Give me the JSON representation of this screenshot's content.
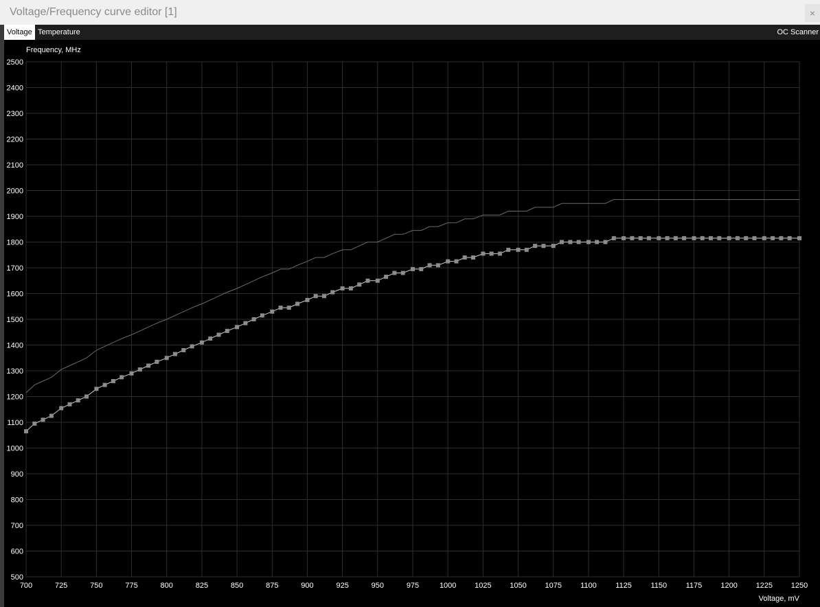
{
  "window": {
    "title": "Voltage/Frequency curve editor [1]",
    "close_glyph": "×"
  },
  "tabs": [
    {
      "label": "Voltage",
      "active": true
    },
    {
      "label": "Temperature",
      "active": false
    }
  ],
  "toolbar": {
    "oc_scanner_label": "OC Scanner"
  },
  "colors": {
    "background": "#000000",
    "grid": "#2e2e2e",
    "curve": "#d0d0d0",
    "upper_line": "#6a6a6a",
    "point": "#8c8c8c",
    "text": "#ffffff"
  },
  "chart_data": {
    "type": "line",
    "ylabel": "Frequency, MHz",
    "xlabel": "Voltage, mV",
    "xlim": [
      700,
      1250
    ],
    "ylim": [
      500,
      2500
    ],
    "x_ticks": [
      "700",
      "725",
      "750",
      "775",
      "800",
      "825",
      "850",
      "875",
      "900",
      "925",
      "950",
      "975",
      "1000",
      "1025",
      "1050",
      "1075",
      "1100",
      "1125",
      "1150",
      "1175",
      "1200",
      "1225",
      "1250"
    ],
    "y_ticks": [
      "500",
      "600",
      "700",
      "800",
      "900",
      "1000",
      "1100",
      "1200",
      "1300",
      "1400",
      "1500",
      "1600",
      "1700",
      "1800",
      "1900",
      "2000",
      "2100",
      "2200",
      "2300",
      "2400",
      "2500"
    ],
    "grid": true,
    "series": [
      {
        "role": "curve",
        "x": [
          700,
          706,
          712,
          718,
          725,
          731,
          737,
          743,
          750,
          756,
          762,
          768,
          775,
          781,
          787,
          793,
          800,
          806,
          812,
          818,
          825,
          831,
          837,
          843,
          850,
          856,
          862,
          868,
          875,
          881,
          887,
          893,
          900,
          906,
          912,
          918,
          925,
          931,
          937,
          943,
          950,
          956,
          962,
          968,
          975,
          981,
          987,
          993,
          1000,
          1006,
          1012,
          1018,
          1025,
          1031,
          1037,
          1043,
          1050,
          1056,
          1062,
          1068,
          1075,
          1081,
          1087,
          1093,
          1100,
          1106,
          1112,
          1118,
          1125,
          1131,
          1137,
          1143,
          1150,
          1156,
          1162,
          1168,
          1175,
          1181,
          1187,
          1193,
          1200,
          1206,
          1212,
          1218,
          1225,
          1231,
          1237,
          1243,
          1250
        ],
        "y": [
          1065,
          1095,
          1110,
          1125,
          1155,
          1170,
          1185,
          1200,
          1230,
          1245,
          1260,
          1275,
          1290,
          1305,
          1320,
          1335,
          1350,
          1365,
          1380,
          1395,
          1410,
          1425,
          1440,
          1455,
          1470,
          1485,
          1500,
          1515,
          1530,
          1545,
          1545,
          1560,
          1575,
          1590,
          1590,
          1605,
          1620,
          1620,
          1635,
          1650,
          1650,
          1665,
          1680,
          1680,
          1695,
          1695,
          1710,
          1710,
          1725,
          1725,
          1740,
          1740,
          1755,
          1755,
          1755,
          1770,
          1770,
          1770,
          1785,
          1785,
          1785,
          1800,
          1800,
          1800,
          1800,
          1800,
          1800,
          1815,
          1815,
          1815,
          1815,
          1815,
          1815,
          1815,
          1815,
          1815,
          1815,
          1815,
          1815,
          1815,
          1815,
          1815,
          1815,
          1815,
          1815,
          1815,
          1815,
          1815,
          1815
        ]
      },
      {
        "role": "reference",
        "x": [
          700,
          706,
          712,
          718,
          725,
          731,
          737,
          743,
          750,
          756,
          762,
          768,
          775,
          781,
          787,
          793,
          800,
          806,
          812,
          818,
          825,
          831,
          837,
          843,
          850,
          856,
          862,
          868,
          875,
          881,
          887,
          893,
          900,
          906,
          912,
          918,
          925,
          931,
          937,
          943,
          950,
          956,
          962,
          968,
          975,
          981,
          987,
          993,
          1000,
          1006,
          1012,
          1018,
          1025,
          1031,
          1037,
          1043,
          1050,
          1056,
          1062,
          1068,
          1075,
          1081,
          1087,
          1093,
          1100,
          1106,
          1112,
          1118,
          1125,
          1250
        ],
        "y": [
          1215,
          1245,
          1260,
          1275,
          1305,
          1320,
          1335,
          1350,
          1380,
          1395,
          1410,
          1425,
          1440,
          1455,
          1470,
          1485,
          1500,
          1515,
          1530,
          1545,
          1560,
          1575,
          1590,
          1605,
          1620,
          1635,
          1650,
          1665,
          1680,
          1695,
          1695,
          1710,
          1725,
          1740,
          1740,
          1755,
          1770,
          1770,
          1785,
          1800,
          1800,
          1815,
          1830,
          1830,
          1845,
          1845,
          1860,
          1860,
          1875,
          1875,
          1890,
          1890,
          1905,
          1905,
          1905,
          1920,
          1920,
          1920,
          1935,
          1935,
          1935,
          1950,
          1950,
          1950,
          1950,
          1950,
          1950,
          1965,
          1965,
          1965
        ]
      }
    ]
  }
}
